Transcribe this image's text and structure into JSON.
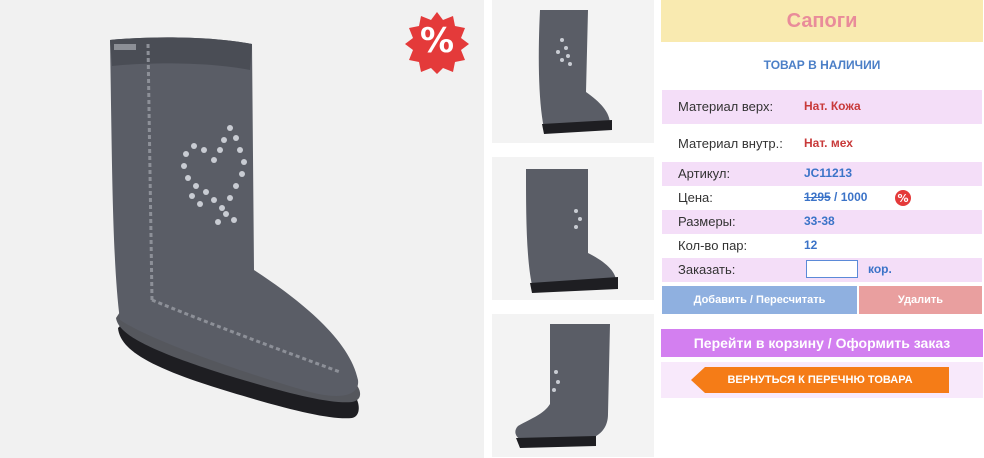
{
  "product": {
    "title": "Сапоги",
    "stock_status": "ТОВАР В НАЛИЧИИ",
    "sale_symbol": "%",
    "specs": {
      "material_top_label": "Материал верх:",
      "material_top_value": "Нат. Кожа",
      "material_inner_label": "Материал внутр.:",
      "material_inner_value": "Нат. мех",
      "article_label": "Артикул:",
      "article_value": "JC11213",
      "price_label": "Цена:",
      "price_old": "1295",
      "price_sep": " / ",
      "price_new": "1000",
      "sizes_label": "Размеры:",
      "sizes_value": "33-38",
      "pairs_label": "Кол-во пар:",
      "pairs_value": "12",
      "order_label": "Заказать:",
      "order_value": "",
      "order_unit": "кор."
    }
  },
  "actions": {
    "add_recalc": "Добавить / Пересчитать",
    "delete": "Удалить",
    "go_cart": "Перейти в корзину / Оформить заказ",
    "back": "ВЕРНУТЬСЯ К ПЕРЕЧНЮ ТОВАРА"
  },
  "colors": {
    "title_bg": "#f9eab0",
    "title_text": "#e98c9a",
    "accent_blue": "#3b73c8",
    "accent_red": "#c83a3a",
    "row_pink": "#f4def8",
    "cart_button": "#d37ff0",
    "back_button": "#f57c17",
    "sale_badge": "#e43a3a"
  },
  "icons": {
    "sale_badge": "percent-burst-icon",
    "back_arrow": "arrow-left-icon"
  }
}
